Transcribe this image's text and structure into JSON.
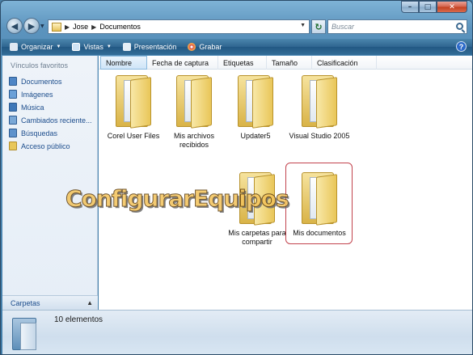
{
  "address": {
    "path": [
      "Jose",
      "Documentos"
    ]
  },
  "search": {
    "placeholder": "Buscar"
  },
  "toolbar": {
    "organize": "Organizar",
    "views": "Vistas",
    "slideshow": "Presentación",
    "burn": "Grabar",
    "help": "?"
  },
  "leftpane": {
    "title": "Vínculos favoritos",
    "items": [
      {
        "label": "Documentos",
        "icon": "documents-icon"
      },
      {
        "label": "Imágenes",
        "icon": "pictures-icon"
      },
      {
        "label": "Música",
        "icon": "music-icon"
      },
      {
        "label": "Cambiados reciente...",
        "icon": "recent-icon"
      },
      {
        "label": "Búsquedas",
        "icon": "searches-icon"
      },
      {
        "label": "Acceso público",
        "icon": "public-icon"
      }
    ],
    "folders_label": "Carpetas"
  },
  "columns": [
    "Nombre",
    "Fecha de captura",
    "Etiquetas",
    "Tamaño",
    "Clasificación"
  ],
  "items": [
    {
      "label": "Corel User Files"
    },
    {
      "label": "Mis archivos recibidos"
    },
    {
      "label": "Updater5"
    },
    {
      "label": "Visual Studio 2005"
    },
    {
      "label": "Mis carpetas para compartir"
    },
    {
      "label": "Mis documentos"
    }
  ],
  "watermark": "ConfigurarEquipos",
  "status": {
    "count": "10 elementos"
  },
  "colors": {
    "link": "#1c4d8c",
    "toolbar": "#2f6590",
    "selection": "#c2434d"
  }
}
